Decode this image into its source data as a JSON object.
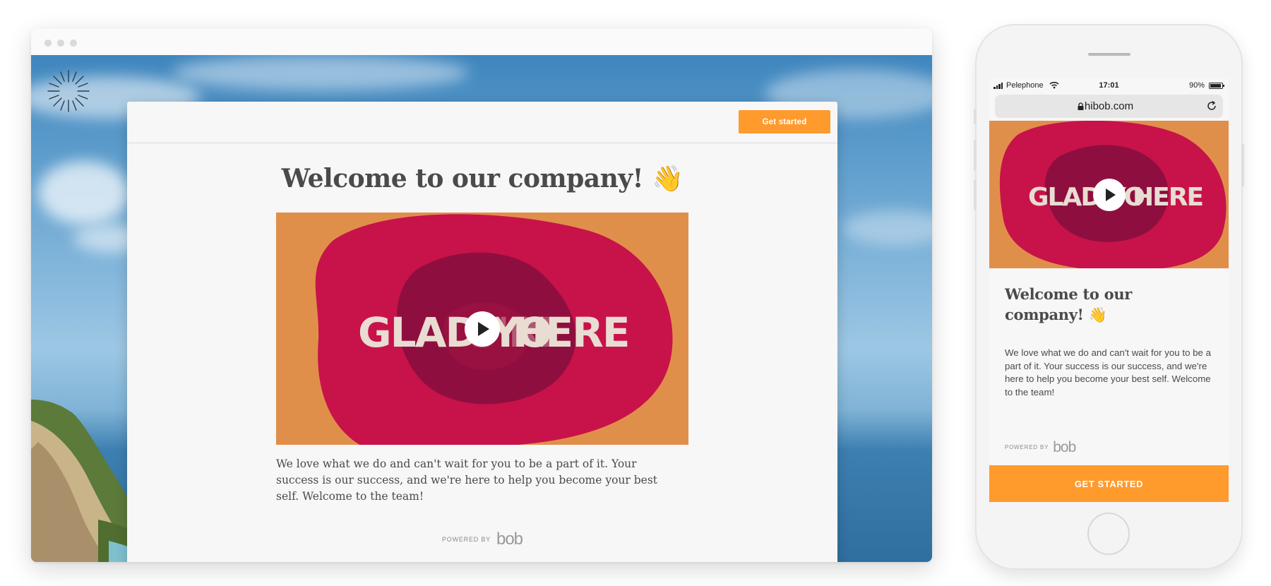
{
  "desktop": {
    "header": {
      "cta_label": "Get started"
    },
    "main": {
      "title": "Welcome to our company! 👋",
      "video": {
        "text_left": "GLAD YO",
        "text_mid": "U'RE",
        "text_right": "HERE"
      },
      "body": "We love what we do and can't wait for you to be a part of it. Your success is our success, and we're here to help you become your best self. Welcome to the team!"
    },
    "footer": {
      "powered_by": "POWERED BY",
      "brand": "bob"
    }
  },
  "mobile": {
    "status": {
      "carrier": "Pelephone",
      "time": "17:01",
      "battery": "90%"
    },
    "url": "hibob.com",
    "video": {
      "text_left": "GLAD YO",
      "text_right": "HERE"
    },
    "title": "Welcome to our company! 👋",
    "body": "We love what we do and can't wait for you to be a part of it. Your success is our success, and we're here to help you become your best self. Welcome to the team!",
    "powered_by": "POWERED BY",
    "brand": "bob",
    "cta_label": "GET STARTED"
  },
  "colors": {
    "accent_orange": "#ff9a2d",
    "video_bg": "#e08f4a",
    "video_pink": "#c8124a",
    "video_dark": "#8e0f3f",
    "text_gray": "#4a4a4a"
  }
}
